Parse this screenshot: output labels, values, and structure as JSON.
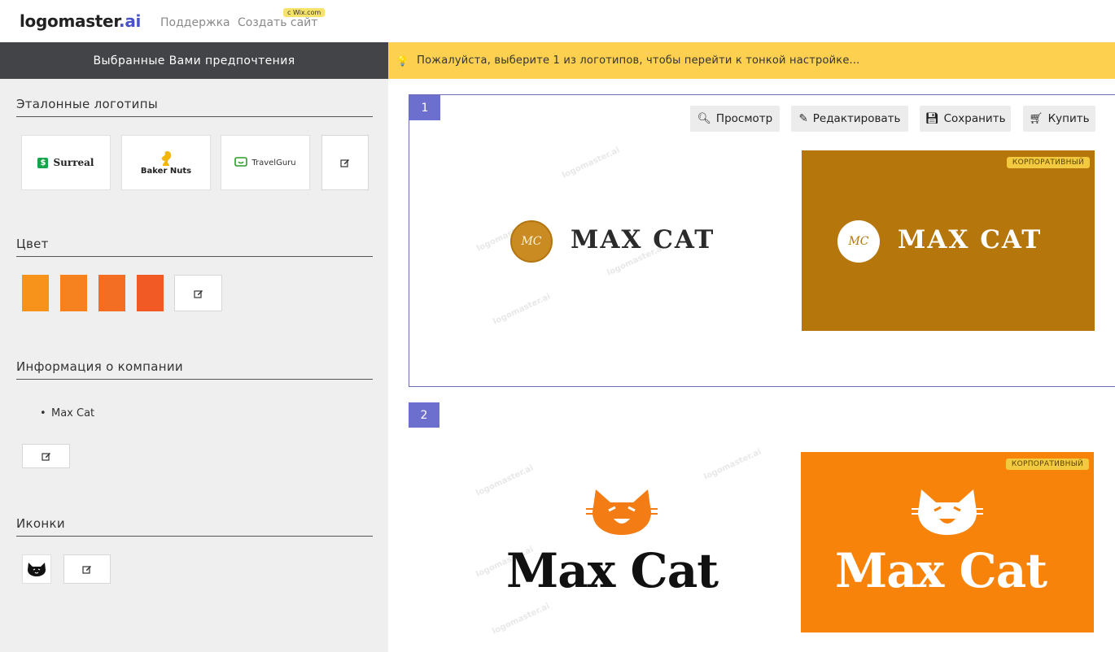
{
  "header": {
    "brand_main": "logomaster",
    "brand_tld": ".ai",
    "nav_support": "Поддержка",
    "nav_site": "Создать сайт",
    "wix_badge": "с Wix.com"
  },
  "sidebar": {
    "title": "Выбранные Вами предпочтения",
    "sections": {
      "ref_logos": "Эталонные логотипы",
      "color": "Цвет",
      "company": "Информация о компании",
      "icons": "Иконки"
    },
    "ref_logos": [
      "Surreal",
      "Baker Nuts",
      "TravelGuru"
    ],
    "colors": [
      "#f7931b",
      "#f5811f",
      "#f36d23",
      "#f15a24"
    ],
    "company_items": [
      "Max Cat"
    ]
  },
  "notice": {
    "text": "Пожалуйста, выберите 1 из логотипов, чтобы перейти к тонкой настройке..."
  },
  "actions": {
    "preview": "Просмотр",
    "edit": "Редактировать",
    "save": "Сохранить",
    "buy": "Купить"
  },
  "logos": [
    {
      "number": "1",
      "wordmark": "MAX CAT",
      "monogram": "MC",
      "tag": "КОРПОРАТИВНЫЙ",
      "bg_color": "#b5760c",
      "accent_color": "#c4851a"
    },
    {
      "number": "2",
      "wordmark": "Max Cat",
      "tag": "КОРПОРАТИВНЫЙ",
      "bg_color": "#f7830b",
      "accent_color": "#f47c14"
    }
  ],
  "watermark": "logomaster.ai"
}
